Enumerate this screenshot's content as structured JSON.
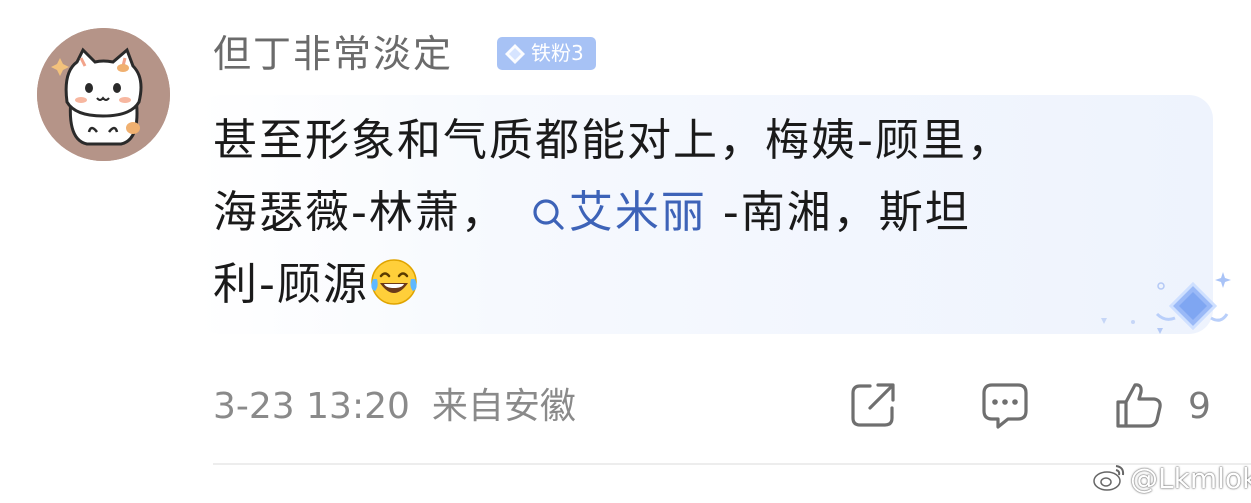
{
  "user": {
    "name": "但丁非常淡定",
    "badge": "铁粉3",
    "avatar": "cat-avatar"
  },
  "comment": {
    "line1": "甚至形象和气质都能对上，梅姨-顾里，",
    "line2_prefix": "海瑟薇-林萧，",
    "search_link": "艾米丽",
    "line2_suffix": " -南湘，斯坦",
    "line3": "利-顾源",
    "emoji": "laughing-tears-emoji"
  },
  "meta": {
    "time": "3-23 13:20",
    "location": "来自安徽"
  },
  "actions": {
    "share_icon": "share-icon",
    "comment_icon": "comment-icon",
    "like_icon": "thumbs-up-icon",
    "like_count": "9"
  },
  "watermark": {
    "text": "@Lkmlok"
  },
  "colors": {
    "link": "#3d63b8",
    "badge_bg": "#a7c2f5",
    "meta_text": "#8a8a8a",
    "bubble_bg": "#eef3fd"
  }
}
